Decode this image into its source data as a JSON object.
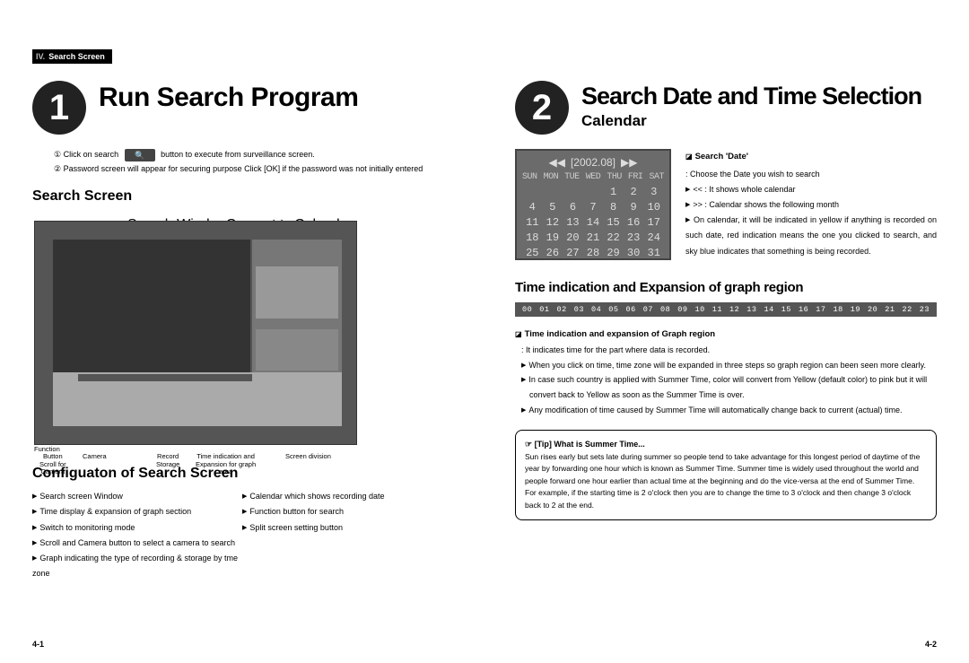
{
  "section_tab": {
    "num": "IV.",
    "label": "Search Screen"
  },
  "left": {
    "big_num": "1",
    "title": "Run Search Program",
    "instr1_a": "① Click on search",
    "instr1_b": "button to execute from surveillance screen.",
    "instr2": "② Password screen will appear for securing purpose Click [OK] if the password was not initially entered",
    "sub_title": "Search Screen",
    "callouts": {
      "top": {
        "search_window": "Search Window",
        "convert": "Convert to\nsurveillance mode",
        "calendar": "Calendar"
      },
      "right": {
        "function": "Function"
      },
      "bottom": {
        "button_scroll": "Button\nScroll for\nCamera",
        "camera": "Camera",
        "record_storage": "Record\nStorage",
        "time_exp": "Time indication and\nExpansion for graph\narea",
        "screen_div": "Screen division"
      }
    },
    "config_title": "Configuaton of Search Screen",
    "config_left": [
      "Search screen Window",
      "Time display & expansion of graph section",
      "Switch to monitoring mode",
      "Scroll and Camera button to select a camera to search",
      "Graph indicating the type of recording & storage by tme zone"
    ],
    "config_right": [
      "Calendar which shows recording date",
      "Function button for search",
      "Split screen setting button"
    ],
    "page_num": "4-1"
  },
  "right": {
    "big_num": "2",
    "title": "Search Date and Time Selection",
    "sub_title": "Calendar",
    "calendar": {
      "month": "[2002.08]",
      "prev": "◀◀",
      "next": "▶▶",
      "days": [
        "SUN",
        "MON",
        "TUE",
        "WED",
        "THU",
        "FRI",
        "SAT"
      ],
      "cells": [
        "",
        "",
        "",
        "",
        "1",
        "2",
        "3",
        "4",
        "5",
        "6",
        "7",
        "8",
        "9",
        "10",
        "11",
        "12",
        "13",
        "14",
        "15",
        "16",
        "17",
        "18",
        "19",
        "20",
        "21",
        "22",
        "23",
        "24",
        "25",
        "26",
        "27",
        "28",
        "29",
        "30",
        "31"
      ]
    },
    "search_date": {
      "head": "Search 'Date'",
      "line1": ": Choose the Date you wish to search",
      "line2": "<< : It shows whole calendar",
      "line3": ">> : Calendar shows the following month",
      "line4": "On calendar, it will be indicated in yellow if anything is recorded on such date, red indication means the one you clicked to search, and sky blue indicates that something is being recorded."
    },
    "time_title": "Time indication and Expansion of graph region",
    "time_bar": [
      "00",
      "01",
      "02",
      "03",
      "04",
      "05",
      "06",
      "07",
      "08",
      "09",
      "10",
      "11",
      "12",
      "13",
      "14",
      "15",
      "16",
      "17",
      "18",
      "19",
      "20",
      "21",
      "22",
      "23"
    ],
    "time_head": "Time indication and expansion of Graph region",
    "time_items": [
      ": It indicates time for the part where data is recorded.",
      "When you click on time, time zone will be expanded in three steps so graph region can been seen more clearly.",
      "In case such country is applied with Summer Time, color will convert from Yellow (default color) to pink but it will convert back to Yellow as soon as the Summer Time is over.",
      "Any modification of time caused by Summer Time will automatically change back to current (actual) time."
    ],
    "tip": {
      "head": "☞  [Tip] What is Summer Time...",
      "body": "Sun rises early but sets late during summer so people tend to take advantage for this longest period of daytime of the year by forwarding one hour which is known as Summer Time. Summer time is widely used throughout the world and people forward one hour earlier than actual time at the beginning and do the vice-versa at the end of Summer Time. For example, if the starting time is 2 o'clock then you are to change the time to 3 o'clock and then change 3 o'clock back to 2 at the end."
    },
    "page_num": "4-2"
  }
}
